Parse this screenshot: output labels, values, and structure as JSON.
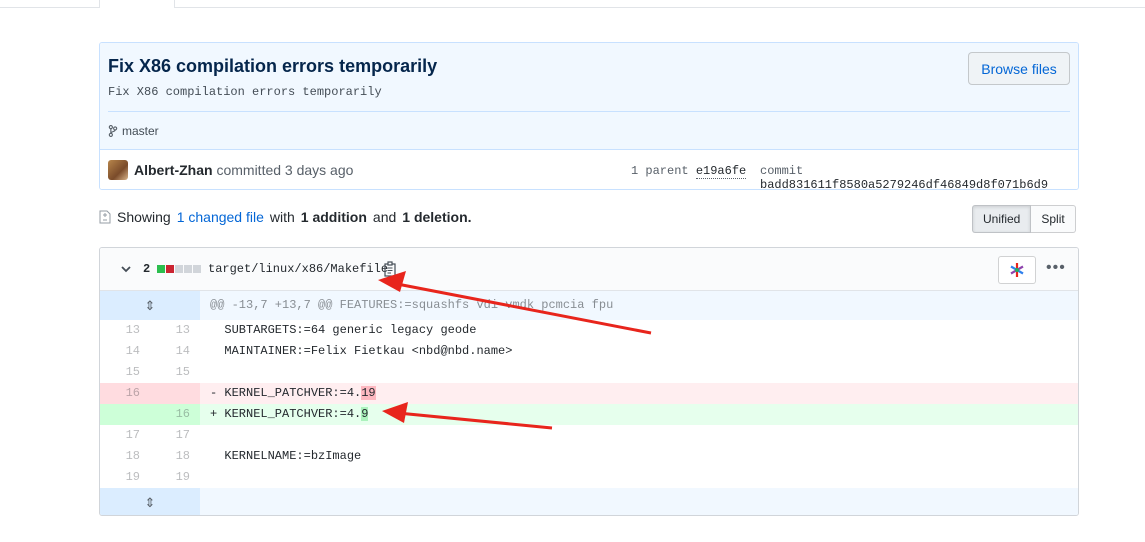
{
  "commit": {
    "title": "Fix X86 compilation errors temporarily",
    "description": "Fix X86 compilation errors temporarily",
    "browse_label": "Browse files",
    "branch": "master",
    "author": "Albert-Zhan",
    "committed_text": "committed 3 days ago",
    "parent_label": "1 parent",
    "parent_sha": "e19a6fe",
    "commit_label": "commit",
    "commit_sha": "badd831611f8580a5279246df46849d8f071b6d9"
  },
  "summary": {
    "showing": "Showing",
    "changed_link": "1 changed file",
    "with": "with",
    "additions": "1 addition",
    "and": "and",
    "deletions": "1 deletion."
  },
  "view_toggle": {
    "unified_label": "Unified",
    "split_label": "Split",
    "selected": "Unified"
  },
  "file": {
    "change_count": "2",
    "path": "target/linux/x86/Makefile",
    "diffstat_colors": [
      "#2cbe4e",
      "#cb2431",
      "#d1d5da",
      "#d1d5da",
      "#d1d5da"
    ],
    "hunk_header": "@@ -13,7 +13,7 @@ FEATURES:=squashfs vdi vmdk pcmcia fpu",
    "lines": [
      {
        "type": "context",
        "old": "13",
        "new": "13",
        "text": "  SUBTARGETS:=64 generic legacy geode"
      },
      {
        "type": "context",
        "old": "14",
        "new": "14",
        "text": "  MAINTAINER:=Felix Fietkau <nbd@nbd.name>"
      },
      {
        "type": "context",
        "old": "15",
        "new": "15",
        "text": ""
      },
      {
        "type": "deletion",
        "old": "16",
        "new": "",
        "prefix": "- KERNEL_PATCHVER:=4.",
        "highlight": "19"
      },
      {
        "type": "addition",
        "old": "",
        "new": "16",
        "prefix": "+ KERNEL_PATCHVER:=4.",
        "highlight": "9"
      },
      {
        "type": "context",
        "old": "17",
        "new": "17",
        "text": ""
      },
      {
        "type": "context",
        "old": "18",
        "new": "18",
        "text": "  KERNELNAME:=bzImage"
      },
      {
        "type": "context",
        "old": "19",
        "new": "19",
        "text": ""
      }
    ]
  },
  "icons": [
    "git-branch-icon",
    "file-diff-icon",
    "chevron-down-icon",
    "clipboard-icon",
    "kebab-horizontal-icon",
    "unfold-icon"
  ],
  "colors": {
    "link": "#0366d6",
    "annotation_arrow": "#e8251c"
  }
}
